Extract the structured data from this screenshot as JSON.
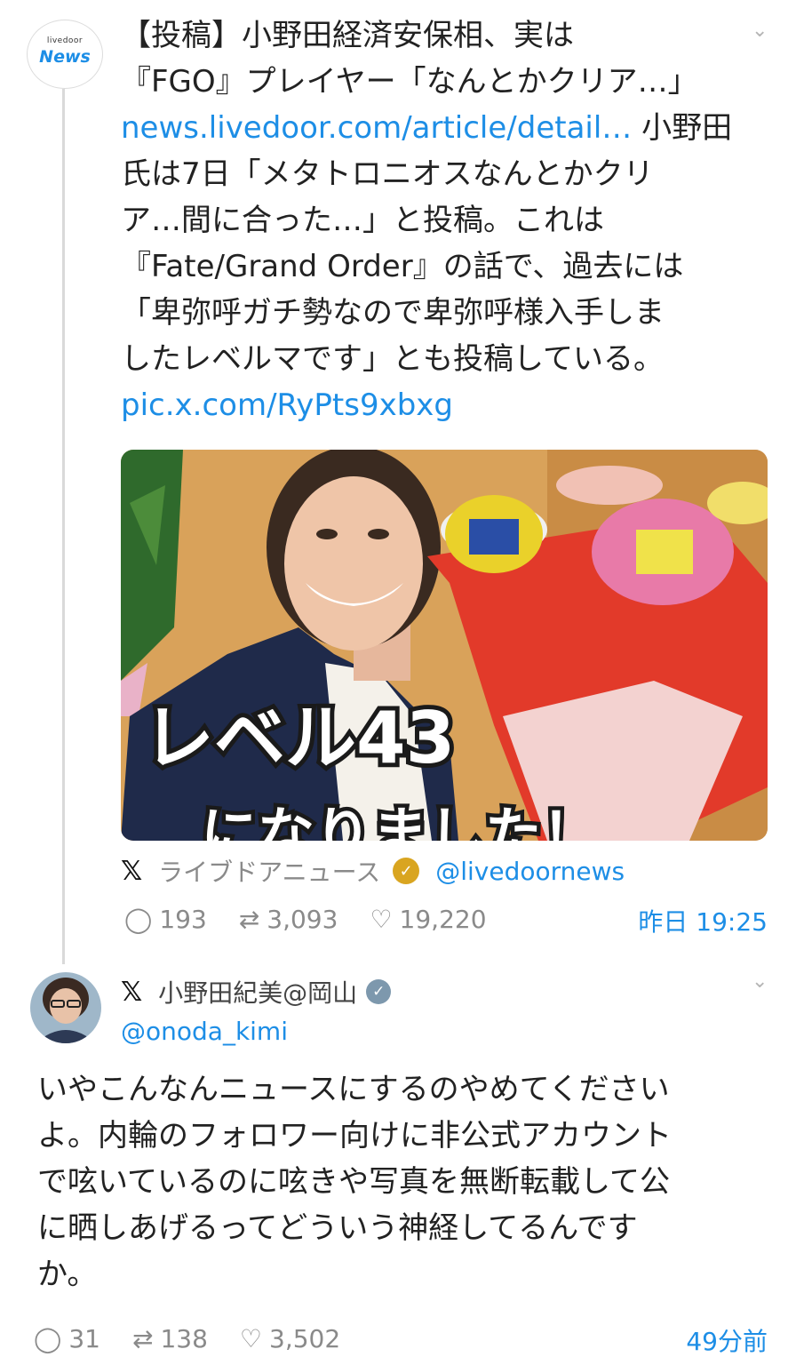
{
  "tweet1": {
    "avatar": {
      "line1": "livedoor",
      "line2": "News"
    },
    "text_lines": [
      "【投稿】小野田経済安保相、実は",
      "『FGO』プレイヤー「なんとかクリア…」"
    ],
    "link1": "news.livedoor.com/article/detail…",
    "body_after_link": " 小野田",
    "body_lines": [
      "氏は7日「メタトロニオスなんとかクリ",
      "ア…間に合った…」と投稿。これは",
      "『Fate/Grand Order』の話で、過去には",
      "「卑弥呼ガチ勢なので卑弥呼様入手しま",
      "したレベルマです」とも投稿している。"
    ],
    "link2": "pic.x.com/RyPts9xbxg",
    "photo_caption_line1": "レベル43",
    "photo_caption_line2": "になりました！",
    "source_name": "ライブドアニュース",
    "source_handle": "@livedoornews",
    "replies": "193",
    "retweets": "3,093",
    "likes": "19,220",
    "time": "昨日 19:25"
  },
  "tweet2": {
    "name": "小野田紀美@岡山",
    "handle": "@onoda_kimi",
    "text_lines": [
      "いやこんなんニュースにするのやめてください",
      "よ。内輪のフォロワー向けに非公式アカウント",
      "で呟いているのに呟きや写真を無断転載して公",
      "に晒しあげるってどういう神経してるんです",
      "か。"
    ],
    "replies": "31",
    "retweets": "138",
    "likes": "3,502",
    "time": "49分前"
  },
  "icons": [
    "livedoor-news-avatar",
    "chevron-down-icon",
    "x-logo-icon",
    "verified-gold-icon",
    "verified-blue-icon",
    "reply-icon",
    "retweet-icon",
    "like-icon"
  ],
  "colors": {
    "link": "#1d8ee6",
    "muted": "#8a8a8a",
    "gold_badge": "#d9a520",
    "blue_badge": "#7d98ad"
  }
}
